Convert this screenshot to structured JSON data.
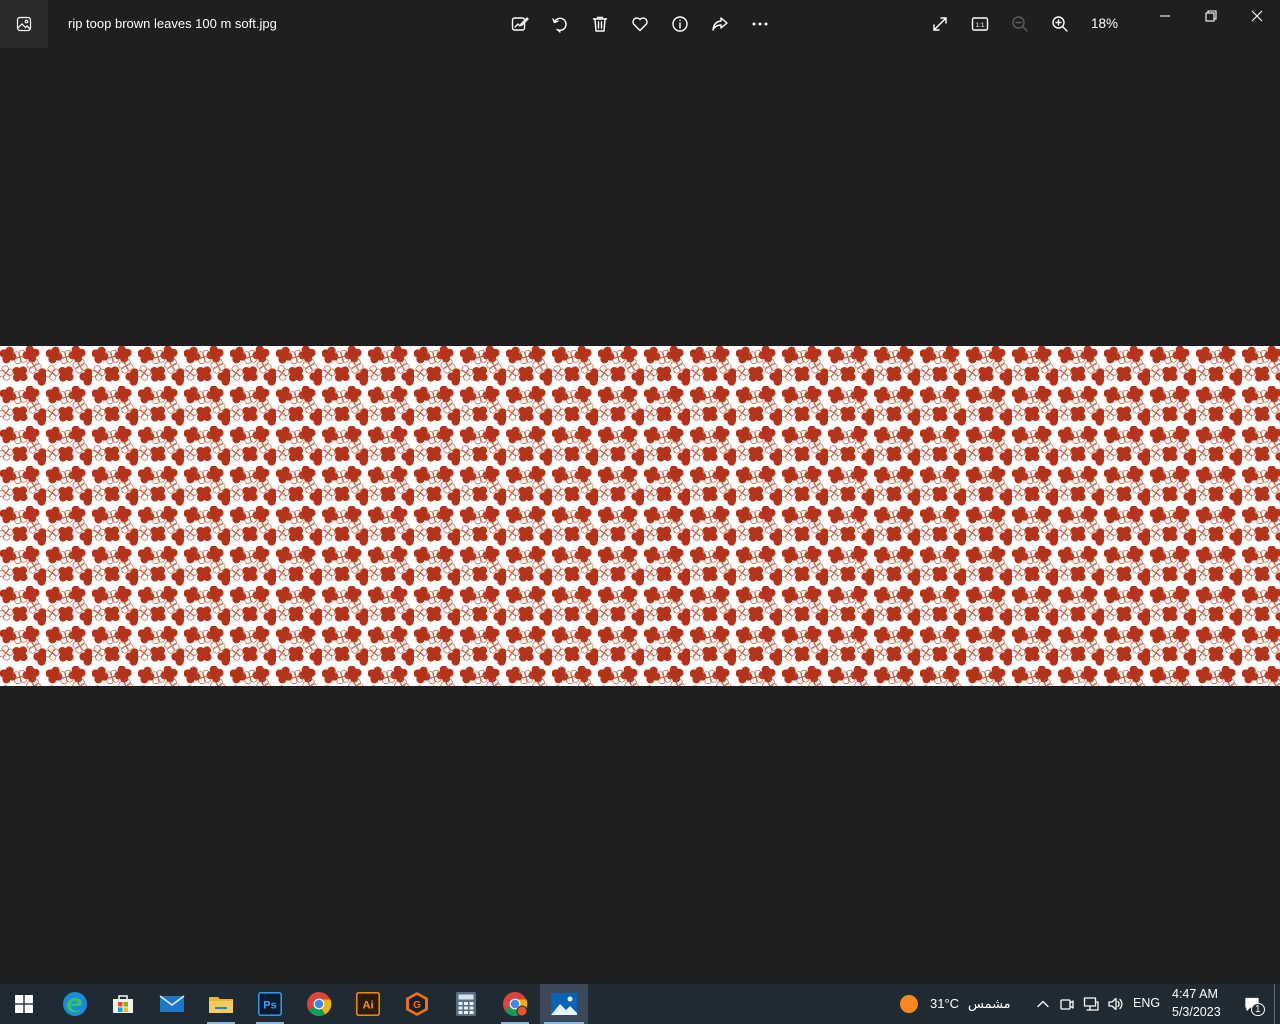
{
  "window": {
    "file_name": "rip toop brown leaves 100 m soft.jpg",
    "zoom_label": "18%"
  },
  "toolbar": {
    "items": [
      {
        "name": "edit-image",
        "icon": "edit-image-icon"
      },
      {
        "name": "rotate",
        "icon": "rotate-icon"
      },
      {
        "name": "delete",
        "icon": "delete-icon"
      },
      {
        "name": "favorite",
        "icon": "heart-icon"
      },
      {
        "name": "file-info",
        "icon": "info-icon"
      },
      {
        "name": "share",
        "icon": "share-icon"
      },
      {
        "name": "more",
        "icon": "more-icon"
      }
    ],
    "view_items": [
      {
        "name": "fullscreen",
        "icon": "fullscreen-icon"
      },
      {
        "name": "actual-size",
        "icon": "actual-size-icon",
        "text": "1:1"
      },
      {
        "name": "zoom-out",
        "icon": "zoom-out-icon",
        "enabled": false
      },
      {
        "name": "zoom-in",
        "icon": "zoom-in-icon"
      }
    ]
  },
  "photo": {
    "pattern_color": "#b5331a",
    "background": "#ffffff"
  },
  "taskbar": {
    "apps": [
      {
        "name": "start",
        "icon": "windows-logo-icon"
      },
      {
        "name": "edge",
        "icon": "edge-icon"
      },
      {
        "name": "store",
        "icon": "store-icon"
      },
      {
        "name": "mail",
        "icon": "mail-icon"
      },
      {
        "name": "file-explorer",
        "icon": "folder-icon"
      },
      {
        "name": "photoshop",
        "icon": "photoshop-icon",
        "text": "Ps"
      },
      {
        "name": "chrome",
        "icon": "chrome-icon"
      },
      {
        "name": "illustrator",
        "icon": "illustrator-icon",
        "text": "Ai"
      },
      {
        "name": "gimp",
        "icon": "g-app-icon",
        "text": "G"
      },
      {
        "name": "calculator",
        "icon": "calculator-icon"
      },
      {
        "name": "chrome-profile",
        "icon": "chrome-icon"
      },
      {
        "name": "photos",
        "icon": "photos-icon"
      }
    ],
    "weather": {
      "temp": "31°C",
      "condition": "مشمس"
    },
    "language": "ENG",
    "time": "4:47 AM",
    "date": "5/3/2023",
    "notification_count": "1"
  }
}
